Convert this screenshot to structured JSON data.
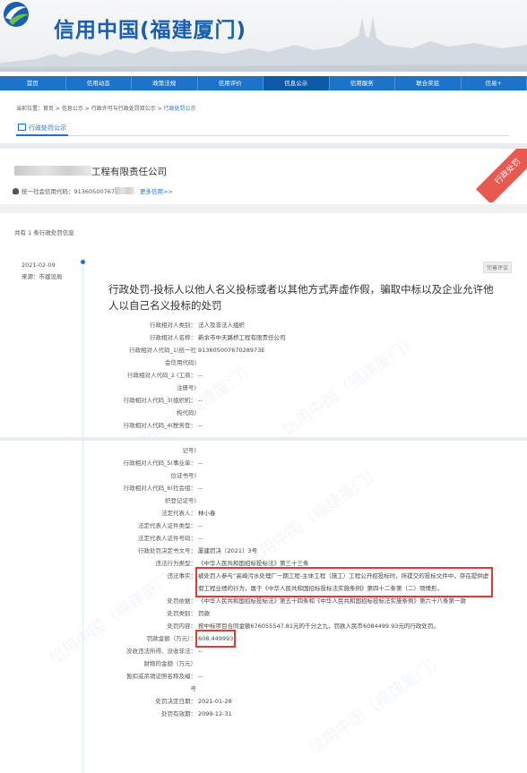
{
  "header": {
    "site_title": "信用中国(福建厦门)",
    "nav": [
      "首页",
      "信用动态",
      "政策法规",
      "信用评价",
      "信息公示",
      "信用服务",
      "联合奖惩",
      "信易+"
    ],
    "nav_active_index": 4,
    "breadcrumb_prefix": "当前位置：",
    "breadcrumb_path": "首页 > 信息公示 > 行政许可与行政处罚双公示 > ",
    "breadcrumb_current": "行政处罚公示",
    "tab_label": "行政处罚公示"
  },
  "company": {
    "name_suffix": "工程有限责任公司",
    "credit_code_label": "统一社会信用代码：",
    "credit_code": "91360500767",
    "more_link": "更多信用>>",
    "ribbon": "行政处罚"
  },
  "summary": {
    "prefix": "共有 ",
    "count": "1",
    "suffix": " 条行政处罚信息"
  },
  "record": {
    "date": "2021-02-09",
    "source": "来源：市建设局",
    "badge": "完善评议",
    "title": "行政处罚-投标人以他人名义投标或者以其他方式弄虚作假，骗取中标以及企业允许他人以自己名义投标的处罚"
  },
  "fields_top": [
    {
      "label": "行政相对人类别：",
      "value": "法人及非法人组织"
    },
    {
      "label": "行政相对人名称：",
      "value": "新余市中天路桥工程有限责任公司"
    },
    {
      "label": "行政相对人代码_1(统一社",
      "value": "91360500767028973E"
    },
    {
      "label": "会信用代码)",
      "value": ""
    },
    {
      "label": "行政相对人代码_2 (工商：",
      "value": "--"
    },
    {
      "label": "注册号)",
      "value": ""
    },
    {
      "label": "行政相对人代码_3(组织机：",
      "value": "--"
    },
    {
      "label": "构代码)",
      "value": ""
    },
    {
      "label": "行政相对人代码_4(税务登：",
      "value": "--"
    }
  ],
  "fields_bottom": [
    {
      "label": "记号)",
      "value": ""
    },
    {
      "label": "行政相对人代码_5(事业单：",
      "value": "--"
    },
    {
      "label": "位证书号)",
      "value": ""
    },
    {
      "label": "行政相对人代码_6(社会组：",
      "value": "--"
    },
    {
      "label": "织登记证号)",
      "value": ""
    },
    {
      "label": "法定代表人：",
      "value": "林小春"
    },
    {
      "label": "法定代表人证件类型：",
      "value": "--"
    },
    {
      "label": "法定代表人证件号码：",
      "value": "--"
    },
    {
      "label": "行政处罚决定书文号：",
      "value": "厦建罚决〔2021〕3号"
    },
    {
      "label": "违法行为类型：",
      "value": "《中华人民共和国招标投标法》第三十三条"
    },
    {
      "label": "违法事实：",
      "value": "被处罚人参与“高崎污水处理厂一期工程-主体工程（施工）工程公开招投标时，所提交的投标文件中，存在提供虚假工程业绩的行为，属于《中华人民共和国招标投标法实施条例》第四十二条第（二）项情形，",
      "highlight": true
    },
    {
      "label": "处罚依据：",
      "value": "《中华人民共和国招标投标法》第五十四条和《中华人民共和国招标投标法实施条例》第六十八条第一款"
    },
    {
      "label": "处罚类别：",
      "value": "罚款"
    },
    {
      "label": "处罚内容：",
      "value": "按中标项目合同金额676055547.81元的千分之九，罚款人民币6084499.93元的行政处罚。"
    },
    {
      "label": "罚款金额（万元）：",
      "value": "608.449993",
      "highlight": true
    },
    {
      "label": "没收违法所得、没收非法：",
      "value": "--"
    },
    {
      "label": "财物的金额（万元）",
      "value": ""
    },
    {
      "label": "暂扣或吊销证照名称及编：",
      "value": "--"
    },
    {
      "label": "号",
      "value": ""
    },
    {
      "label": "处罚决定日期：",
      "value": "2021-01-28"
    },
    {
      "label": "处罚有效期：",
      "value": "2099-12-31"
    }
  ],
  "watermark": "信用中国（福建厦门）",
  "colors": {
    "brand_blue": "#1c73c9",
    "highlight_red": "#e03a32",
    "ribbon_red": "#e85a50"
  }
}
